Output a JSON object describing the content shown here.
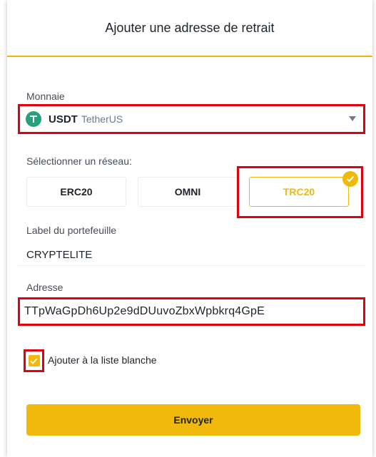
{
  "dialog": {
    "title": "Ajouter une adresse de retrait"
  },
  "coin": {
    "label": "Monnaie",
    "symbol": "USDT",
    "name": "TetherUS",
    "icon": "tether-icon"
  },
  "network": {
    "label": "Sélectionner un réseau:",
    "options": [
      {
        "label": "ERC20"
      },
      {
        "label": "OMNI"
      },
      {
        "label": "TRC20"
      }
    ],
    "selected": "TRC20"
  },
  "wallet_label": {
    "label": "Label du portefeuille",
    "value": "CRYPTELITE"
  },
  "address": {
    "label": "Adresse",
    "value": "TTpWaGpDh6Up2e9dDUuvoZbxWpbkrq4GpE"
  },
  "whitelist": {
    "label": "Ajouter à la liste blanche",
    "checked": true
  },
  "submit": {
    "label": "Envoyer"
  },
  "colors": {
    "accent": "#f0b90b",
    "highlight": "#e0000e",
    "tether": "#26a17b"
  }
}
